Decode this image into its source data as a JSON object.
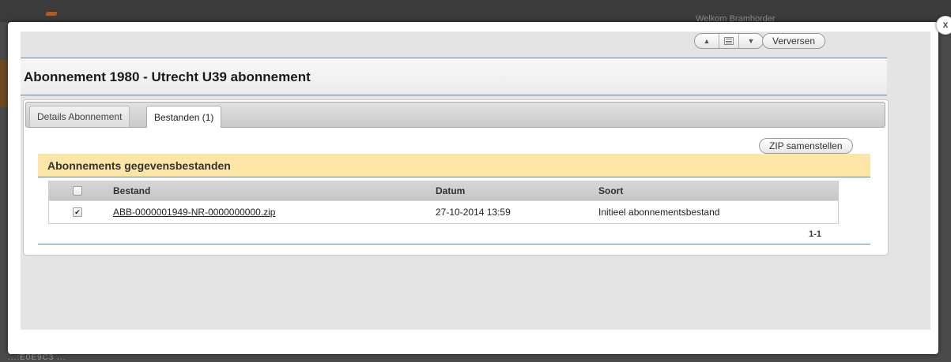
{
  "background": {
    "welcome_text": "Welkom Bramhorder",
    "bottom_text": "...:E0E9C3 ..."
  },
  "close_label": "x",
  "toolbar": {
    "up_icon": "▲",
    "down_icon": "▼",
    "refresh_label": "Verversen"
  },
  "page_title": "Abonnement 1980 - Utrecht U39 abonnement",
  "tabs": [
    {
      "label": "Details Abonnement",
      "active": false
    },
    {
      "label": "Bestanden (1)",
      "active": true
    }
  ],
  "zip_button_label": "ZIP samenstellen",
  "section_title": "Abonnements gegevensbestanden",
  "table": {
    "columns": [
      "Bestand",
      "Datum",
      "Soort"
    ],
    "rows": [
      {
        "checked": true,
        "file": "ABB-0000001949-NR-0000000000.zip",
        "date": "27-10-2014 13:59",
        "type": "Initieel abonnementsbestand"
      }
    ]
  },
  "pager": "1-1",
  "colors": {
    "accent_line": "#4f87b8",
    "section_header_bg": "#fbe6a8"
  }
}
